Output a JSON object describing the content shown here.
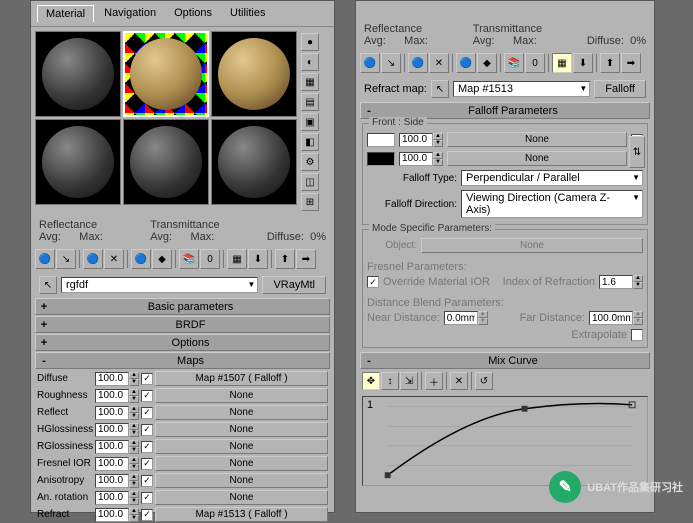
{
  "tabs": [
    "Material",
    "Navigation",
    "Options",
    "Utilities"
  ],
  "active_tab": 0,
  "stats": {
    "reflectance_label": "Reflectance",
    "transmittance_label": "Transmittance",
    "avg_label": "Avg:",
    "max_label": "Max:",
    "diffuse_label": "Diffuse:",
    "diffuse_val": "0%"
  },
  "material_name": "rgfdf",
  "material_type": "VRayMtl",
  "rollouts": {
    "basic": "Basic parameters",
    "brdf": "BRDF",
    "options": "Options",
    "maps": "Maps",
    "falloff": "Falloff Parameters",
    "mode": "Mode Specific Parameters:",
    "mix": "Mix Curve"
  },
  "maps": [
    {
      "name": "Diffuse",
      "val": "100.0",
      "on": true,
      "btn": "Map #1507   ( Falloff )"
    },
    {
      "name": "Roughness",
      "val": "100.0",
      "on": true,
      "btn": "None"
    },
    {
      "name": "Reflect",
      "val": "100.0",
      "on": true,
      "btn": "None"
    },
    {
      "name": "HGlossiness",
      "val": "100.0",
      "on": true,
      "btn": "None"
    },
    {
      "name": "RGlossiness",
      "val": "100.0",
      "on": true,
      "btn": "None"
    },
    {
      "name": "Fresnel IOR",
      "val": "100.0",
      "on": true,
      "btn": "None"
    },
    {
      "name": "Anisotropy",
      "val": "100.0",
      "on": true,
      "btn": "None"
    },
    {
      "name": "An. rotation",
      "val": "100.0",
      "on": true,
      "btn": "None"
    },
    {
      "name": "Refract",
      "val": "100.0",
      "on": true,
      "btn": "Map #1513   ( Falloff )"
    }
  ],
  "refract_map_label": "Refract map:",
  "refract_map_value": "Map #1513",
  "refract_side_btn": "Falloff",
  "front_side_label": "Front : Side",
  "fs_rows": [
    {
      "color": "#fff",
      "val": "100.0",
      "btn": "None",
      "on": true
    },
    {
      "color": "#000",
      "val": "100.0",
      "btn": "None",
      "on": true
    }
  ],
  "falloff_type_label": "Falloff Type:",
  "falloff_type_value": "Perpendicular / Parallel",
  "falloff_dir_label": "Falloff Direction:",
  "falloff_dir_value": "Viewing Direction (Camera Z-Axis)",
  "object_label": "Object:",
  "object_btn": "None",
  "fresnel_params_label": "Fresnel Parameters:",
  "override_ior_label": "Override Material IOR",
  "override_ior_checked": true,
  "ior_label": "Index of Refraction",
  "ior_val": "1.6",
  "distance_label": "Distance Blend Parameters:",
  "near_label": "Near Distance:",
  "near_val": "0.0mm",
  "far_label": "Far Distance:",
  "far_val": "100.0mm",
  "extrapolate_label": "Extrapolate",
  "curve_y0": "1",
  "watermark": "UBAT作品集研习社",
  "chart_data": {
    "type": "line",
    "title": "Mix Curve",
    "xlim": [
      0,
      1
    ],
    "ylim": [
      0,
      1
    ],
    "points": [
      {
        "x": 0.0,
        "y": 0.0
      },
      {
        "x": 0.55,
        "y": 0.9
      },
      {
        "x": 1.0,
        "y": 1.0
      }
    ],
    "interpolation": "bezier"
  }
}
